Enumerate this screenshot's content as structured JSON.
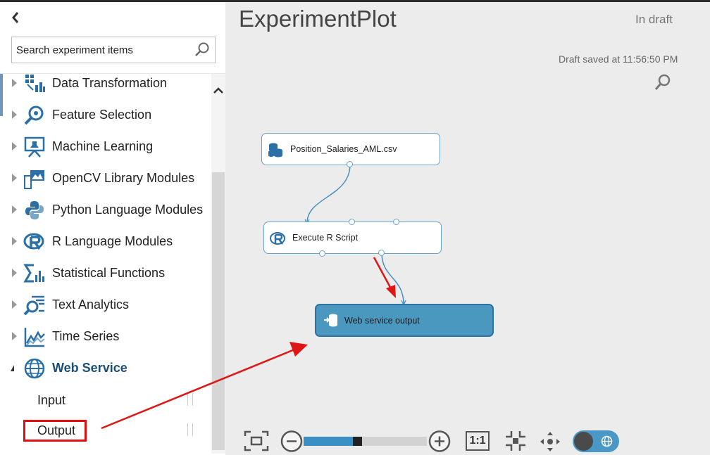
{
  "panel": {
    "search_placeholder": "Search experiment items",
    "categories": [
      {
        "label": "Data Transformation"
      },
      {
        "label": "Feature Selection"
      },
      {
        "label": "Machine Learning"
      },
      {
        "label": "OpenCV Library Modules"
      },
      {
        "label": "Python Language Modules"
      },
      {
        "label": "R Language Modules"
      },
      {
        "label": "Statistical Functions"
      },
      {
        "label": "Text Analytics"
      },
      {
        "label": "Time Series"
      },
      {
        "label": "Web Service"
      }
    ],
    "web_service_items": [
      {
        "label": "Input"
      },
      {
        "label": "Output"
      }
    ]
  },
  "experiment": {
    "title": "ExperimentPlot",
    "status": "In draft",
    "saved": "Draft saved at 11:56:50 PM"
  },
  "modules": [
    {
      "label": "Position_Salaries_AML.csv"
    },
    {
      "label": "Execute R Script"
    },
    {
      "label": "Web service output"
    }
  ],
  "toolbar": {
    "ratio_label": "1:1",
    "zoom_level": 0.4
  },
  "colors": {
    "accent": "#3a8fc4",
    "selected_module": "#4a98c0",
    "highlight_red": "#e01010"
  }
}
